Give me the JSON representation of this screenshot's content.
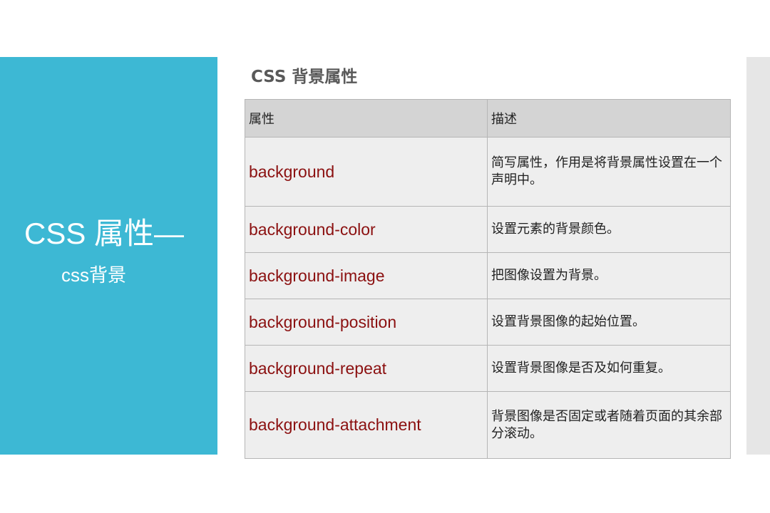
{
  "slide": {
    "section_title": "CSS 属性—",
    "section_subtitle": "css背景",
    "table_heading": "CSS 背景属性"
  },
  "table": {
    "headers": [
      "属性",
      "描述"
    ],
    "rows": [
      {
        "property": "background",
        "description": "简写属性，作用是将背景属性设置在一个声明中。"
      },
      {
        "property": "background-color",
        "description": "设置元素的背景颜色。"
      },
      {
        "property": "background-image",
        "description": "把图像设置为背景。"
      },
      {
        "property": "background-position",
        "description": "设置背景图像的起始位置。"
      },
      {
        "property": "background-repeat",
        "description": "设置背景图像是否及如何重复。"
      },
      {
        "property": "background-attachment",
        "description": "背景图像是否固定或者随着页面的其余部分滚动。"
      }
    ]
  },
  "colors": {
    "accent_panel": "#3db8d4",
    "property_text": "#8b1010",
    "header_row": "#d4d4d4",
    "body_row": "#eeeeee",
    "side_strip": "#e6e6e6"
  }
}
